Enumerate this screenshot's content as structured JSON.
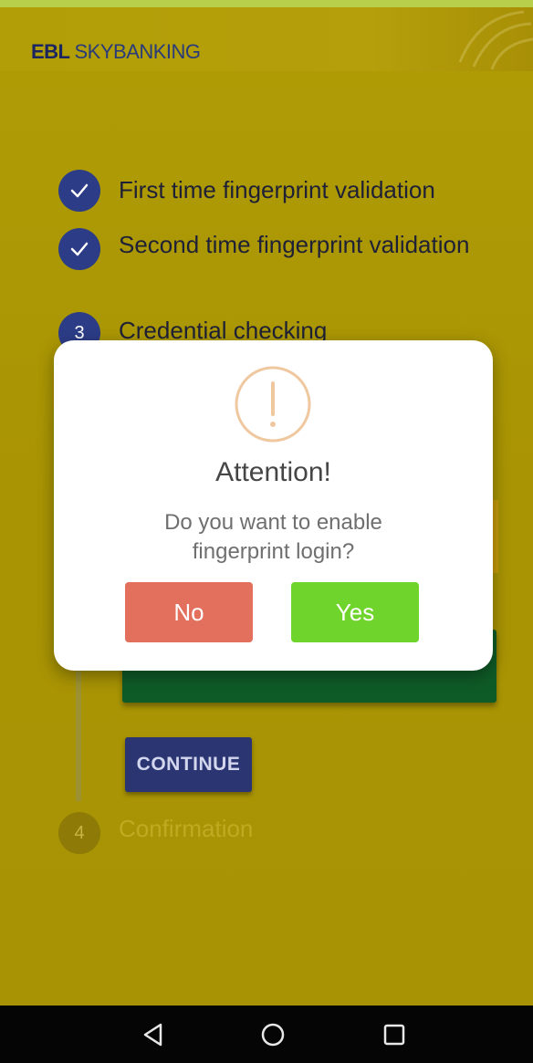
{
  "header": {
    "brand_ebl": "EBL",
    "brand_sky": "SKYBANKING"
  },
  "steps": [
    {
      "number": "",
      "icon": "check-icon",
      "label": "First time fingerprint validation",
      "state": "done"
    },
    {
      "number": "",
      "icon": "check-icon",
      "label": "Second time fingerprint validation",
      "state": "done"
    },
    {
      "number": "3",
      "label": "Credential checking",
      "state": "active"
    },
    {
      "number": "4",
      "label": "Confirmation",
      "state": "pending"
    }
  ],
  "continue_button": {
    "label": "CONTINUE"
  },
  "dialog": {
    "icon": "alert-icon",
    "title": "Attention!",
    "message": "Do you want to enable fingerprint login?",
    "no_label": "No",
    "yes_label": "Yes"
  },
  "navbar": {
    "icons": [
      "back-icon",
      "home-icon",
      "recents-icon"
    ]
  },
  "colors": {
    "background": "#a99404",
    "step_circle": "#2c3c86",
    "no_button": "#e2705d",
    "yes_button": "#6fd42b",
    "continue_button": "#2a3572"
  }
}
